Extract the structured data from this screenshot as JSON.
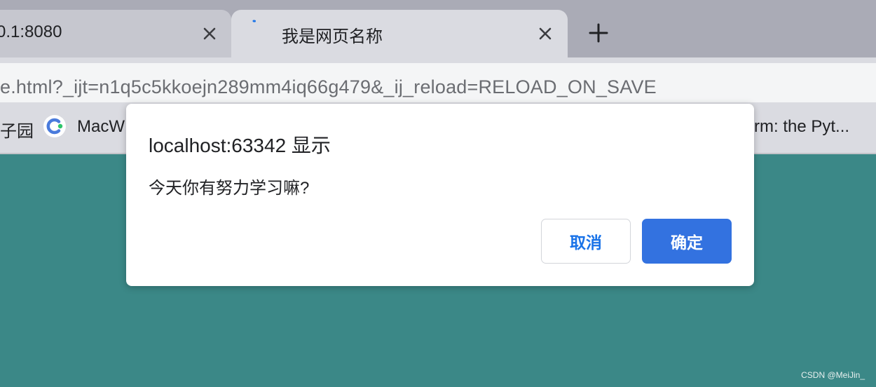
{
  "tabs": [
    {
      "title": "0.1:8080",
      "active": false
    },
    {
      "title": "我是网页名称",
      "active": true
    }
  ],
  "address_bar": {
    "url": "e.html?_ijt=n1q5c5kkoejn289mm4iq66g479&_ij_reload=RELOAD_ON_SAVE"
  },
  "bookmarks": [
    {
      "label": "子园"
    },
    {
      "label": "MacW"
    },
    {
      "label": "rm: the Pyt..."
    }
  ],
  "dialog": {
    "title": "localhost:63342 显示",
    "message": "今天你有努力学习嘛?",
    "cancel_label": "取消",
    "ok_label": "确定"
  },
  "page": {
    "background_color": "#3b8887"
  },
  "icons": {
    "tab_close": "close-icon",
    "new_tab": "plus-icon",
    "tab_loading": "loading-spinner-icon",
    "bookmark_favicon": "c-logo-icon"
  },
  "watermark": "CSDN @MeiJin_"
}
